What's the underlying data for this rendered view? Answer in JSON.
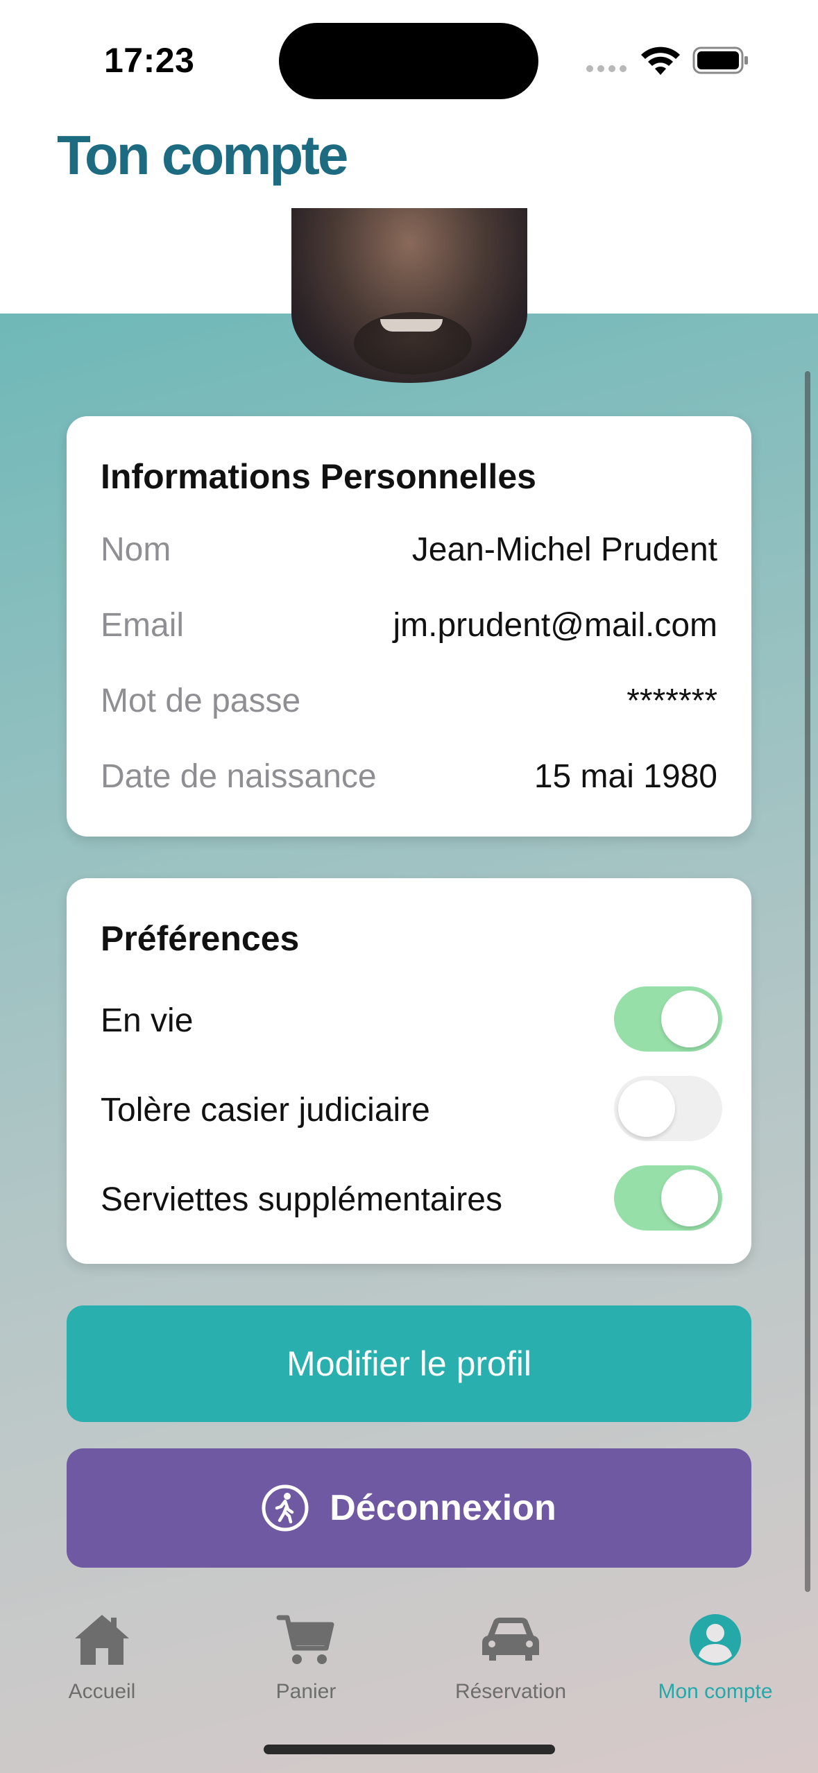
{
  "status_bar": {
    "time": "17:23"
  },
  "header": {
    "title": "Ton compte"
  },
  "personal_info": {
    "title": "Informations Personnelles",
    "rows": [
      {
        "label": "Nom",
        "value": "Jean-Michel Prudent"
      },
      {
        "label": "Email",
        "value": "jm.prudent@mail.com"
      },
      {
        "label": "Mot de passe",
        "value": "*******"
      },
      {
        "label": "Date de naissance",
        "value": "15 mai 1980"
      }
    ]
  },
  "preferences": {
    "title": "Préférences",
    "items": [
      {
        "label": "En vie",
        "enabled": true
      },
      {
        "label": "Tolère casier judiciaire",
        "enabled": false
      },
      {
        "label": "Serviettes supplémentaires",
        "enabled": true
      }
    ]
  },
  "buttons": {
    "edit_profile": "Modifier le profil",
    "logout": "Déconnexion"
  },
  "tabbar": {
    "items": [
      {
        "label": "Accueil",
        "icon": "house-icon",
        "active": false
      },
      {
        "label": "Panier",
        "icon": "cart-icon",
        "active": false
      },
      {
        "label": "Réservation",
        "icon": "car-icon",
        "active": false
      },
      {
        "label": "Mon compte",
        "icon": "person-circle-icon",
        "active": true
      }
    ]
  },
  "colors": {
    "title": "#1d6b80",
    "primary_button": "#29b0ae",
    "logout_button": "#7059a3",
    "toggle_on": "#97dfa8",
    "tab_active": "#25a8a8"
  }
}
